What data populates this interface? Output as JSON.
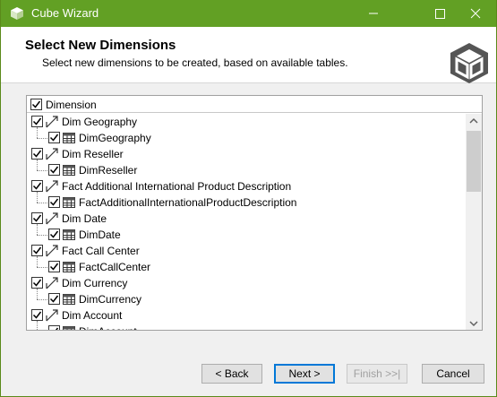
{
  "window": {
    "title": "Cube Wizard",
    "accent_color": "#62a024"
  },
  "header": {
    "title": "Select New Dimensions",
    "subtitle": "Select new dimensions to be created, based on available tables."
  },
  "tree": {
    "column_header": "Dimension",
    "items": [
      {
        "dimension": "Dim Geography",
        "table": "DimGeography"
      },
      {
        "dimension": "Dim Reseller",
        "table": "DimReseller"
      },
      {
        "dimension": "Fact Additional International Product Description",
        "table": "FactAdditionalInternationalProductDescription"
      },
      {
        "dimension": "Dim Date",
        "table": "DimDate"
      },
      {
        "dimension": "Fact Call Center",
        "table": "FactCallCenter"
      },
      {
        "dimension": "Dim Currency",
        "table": "DimCurrency"
      },
      {
        "dimension": "Dim Account",
        "table": "DimAccount"
      }
    ]
  },
  "buttons": {
    "back": "< Back",
    "next": "Next >",
    "finish": "Finish >>|",
    "cancel": "Cancel"
  },
  "icons": {
    "title": "cube-icon",
    "logo": "cube-wizard-logo",
    "dimension": "dimension-icon",
    "table": "table-icon"
  }
}
